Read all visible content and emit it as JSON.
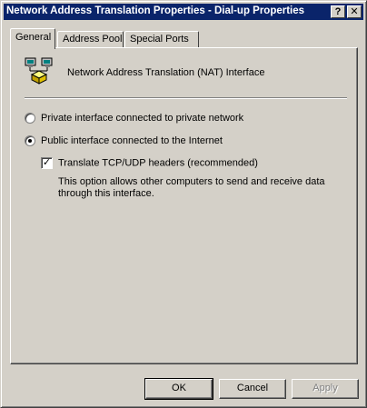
{
  "window": {
    "title": "Network Address Translation Properties - Dial-up  Properties",
    "help_glyph": "?",
    "close_glyph": "✕"
  },
  "tabs": [
    {
      "label": "General",
      "active": true
    },
    {
      "label": "Address Pool",
      "active": false
    },
    {
      "label": "Special Ports",
      "active": false
    }
  ],
  "general": {
    "interface_icon": "network-computers-icon",
    "interface_label": "Network Address Translation (NAT) Interface",
    "options": [
      {
        "label": "Private interface connected to private network",
        "selected": false
      },
      {
        "label": "Public interface connected to the Internet",
        "selected": true
      }
    ],
    "translate": {
      "label": "Translate TCP/UDP headers (recommended)",
      "checked": true,
      "check_glyph": "✓",
      "description": "This option allows other computers to send and receive data through this interface."
    }
  },
  "buttons": {
    "ok": "OK",
    "cancel": "Cancel",
    "apply": "Apply"
  }
}
